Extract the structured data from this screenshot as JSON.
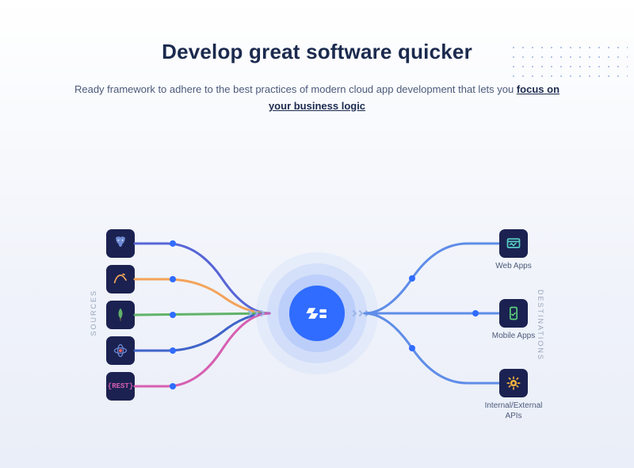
{
  "heading": "Develop great software quicker",
  "subtext_prefix": "Ready framework to adhere to the best practices of modern cloud app development that lets you ",
  "subtext_em": "focus on your business logic",
  "labels": {
    "sources": "SOURCES",
    "destinations": "DESTINATIONS"
  },
  "sources": [
    {
      "icon": "postgresql-icon",
      "color": "#5865d6"
    },
    {
      "icon": "mysql-icon",
      "color": "#f3a35b"
    },
    {
      "icon": "mongodb-icon",
      "color": "#61b36a"
    },
    {
      "icon": "redis-icon",
      "color": "#3f63c9"
    },
    {
      "icon": "rest-icon",
      "color": "#d65fb1",
      "text": "{REST}"
    }
  ],
  "hub": {
    "icon": "framework-logo-icon"
  },
  "destinations": [
    {
      "icon": "web-apps-icon",
      "label": "Web Apps"
    },
    {
      "icon": "mobile-apps-icon",
      "label": "Mobile Apps"
    },
    {
      "icon": "api-gear-icon",
      "label": "Internal/External APIs"
    }
  ],
  "colors": {
    "tile_bg": "#1b2251",
    "hub_bg": "#2f6cff",
    "dest_line": "#5f8de8"
  }
}
